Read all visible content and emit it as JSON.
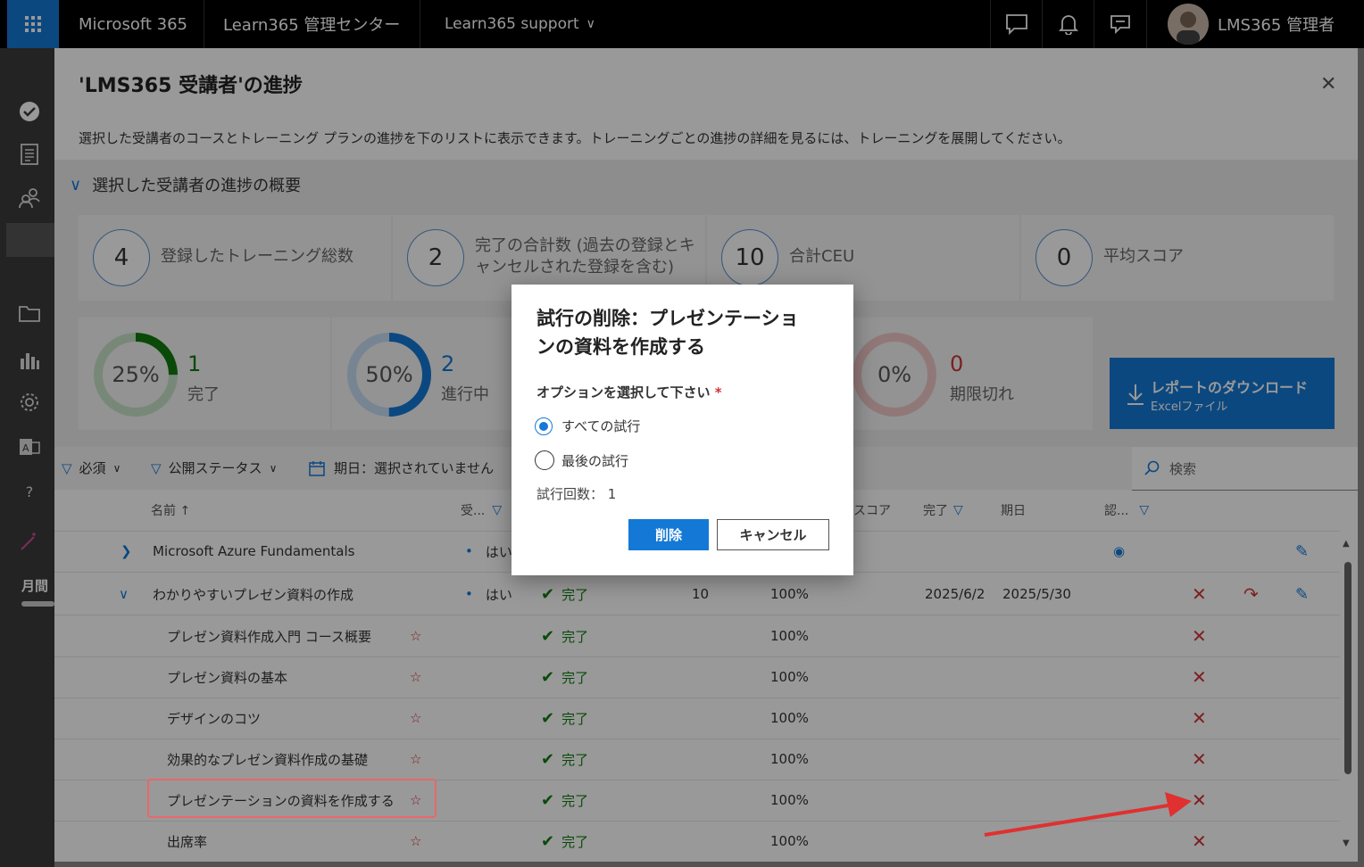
{
  "topbar": {
    "app_name": "Microsoft 365",
    "admin_center": "Learn365 管理センター",
    "support_menu": "Learn365 support",
    "user_name": "LMS365 管理者"
  },
  "rail": {
    "month_label": "月間"
  },
  "panel": {
    "title": "'LMS365 受講者'の進捗",
    "description": "選択した受講者のコースとトレーニング プランの進捗を下のリストに表示できます。トレーニングごとの進捗の詳細を見るには、トレーニングを展開してください。",
    "summary_header": "選択した受講者の進捗の概要",
    "stats": [
      {
        "value": "4",
        "label": "登録したトレーニング総数"
      },
      {
        "value": "2",
        "label": "完了の合計数 (過去の登録とキャンセルされた登録を含む)"
      },
      {
        "value": "10",
        "label": "合計CEU"
      },
      {
        "value": "0",
        "label": "平均スコア"
      }
    ],
    "donuts": [
      {
        "percent_text": "25%",
        "percent": 25,
        "count": "1",
        "label": "完了",
        "color": "#107c10"
      },
      {
        "percent_text": "50%",
        "percent": 50,
        "count": "2",
        "label": "進行中",
        "color": "#1479d6"
      },
      {
        "percent_text": "0%",
        "percent": 0,
        "count": "0",
        "label": "期限切れ",
        "color": "#d13438"
      }
    ],
    "download": {
      "title": "レポートのダウンロード",
      "subtitle": "Excelファイル"
    },
    "filters": {
      "required": "必須",
      "publish_status": "公開ステータス",
      "due_date": "期日：選択されていません",
      "search_placeholder": "検索"
    },
    "columns": {
      "name": "名前 ↑",
      "enrolled": "受...",
      "score": "スコア",
      "completed": "完了",
      "due": "期日",
      "cert": "認..."
    },
    "rows": [
      {
        "name": "Microsoft Azure Fundamentals",
        "required": "はい",
        "status": "",
        "ceu": "",
        "progress": "",
        "completed": "",
        "due": ""
      },
      {
        "name": "わかりやすいプレゼン資料の作成",
        "required": "はい",
        "status": "完了",
        "ceu": "10",
        "progress": "100%",
        "completed": "2025/6/2",
        "due": "2025/5/30"
      },
      {
        "name": "プレゼン資料作成入門 コース概要",
        "status": "完了",
        "progress": "100%"
      },
      {
        "name": "プレゼン資料の基本",
        "status": "完了",
        "progress": "100%"
      },
      {
        "name": "デザインのコツ",
        "status": "完了",
        "progress": "100%"
      },
      {
        "name": "効果的なプレゼン資料作成の基礎",
        "status": "完了",
        "progress": "100%"
      },
      {
        "name": "プレゼンテーションの資料を作成する",
        "status": "完了",
        "progress": "100%"
      },
      {
        "name": "出席率",
        "status": "完了",
        "progress": "100%"
      }
    ]
  },
  "dialog": {
    "title": "試行の削除：プレゼンテーションの資料を作成する",
    "option_label": "オプションを選択して下さい",
    "required_mark": "*",
    "option_all": "すべての試行",
    "option_last": "最後の試行",
    "attempts_text": "試行回数： 1",
    "delete_label": "削除",
    "cancel_label": "キャンセル"
  },
  "colors": {
    "accent": "#1479d6",
    "success": "#107c10",
    "danger": "#d13438",
    "highlight": "#e8686b"
  }
}
